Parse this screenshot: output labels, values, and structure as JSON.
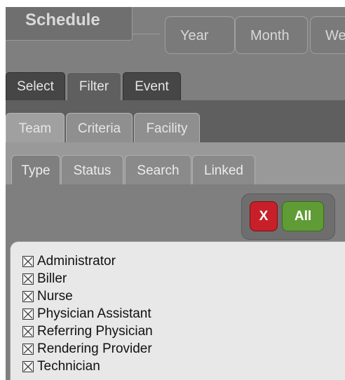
{
  "header": {
    "title": "Schedule",
    "views": [
      "Year",
      "Month",
      "We"
    ]
  },
  "tabs_level1": [
    {
      "label": "Select",
      "active": false
    },
    {
      "label": "Filter",
      "active": true
    },
    {
      "label": "Event",
      "active": false
    }
  ],
  "tabs_level2": [
    {
      "label": "Team",
      "active": true
    },
    {
      "label": "Criteria",
      "active": false
    },
    {
      "label": "Facility",
      "active": false
    }
  ],
  "tabs_level3": [
    {
      "label": "Type",
      "active": true
    },
    {
      "label": "Status",
      "active": false
    },
    {
      "label": "Search",
      "active": false
    },
    {
      "label": "Linked",
      "active": false
    }
  ],
  "actions": {
    "clear_label": "X",
    "all_label": "All",
    "clear_color": "#c8202a",
    "all_color": "#5f9c35"
  },
  "type_list": {
    "items": [
      {
        "label": "Administrator",
        "checked": true
      },
      {
        "label": "Biller",
        "checked": true
      },
      {
        "label": "Nurse",
        "checked": true
      },
      {
        "label": "Physician Assistant",
        "checked": true
      },
      {
        "label": "Referring Physician",
        "checked": true
      },
      {
        "label": "Rendering Provider",
        "checked": true
      },
      {
        "label": "Technician",
        "checked": true
      }
    ]
  }
}
